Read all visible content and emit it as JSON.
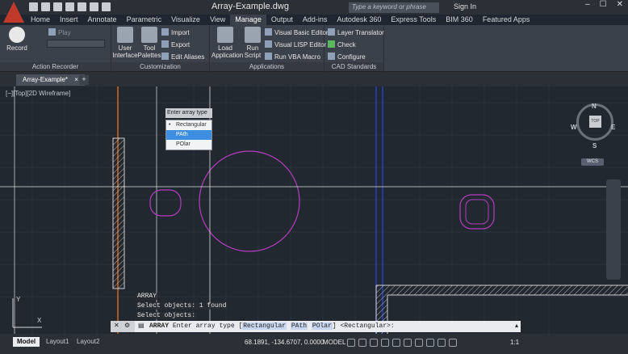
{
  "app": {
    "title": "Array-Example.dwg",
    "search_placeholder": "Type a keyword or phrase",
    "signin": "Sign In"
  },
  "ribbon_tabs": [
    "Home",
    "Insert",
    "Annotate",
    "Parametric",
    "Visualize",
    "View",
    "Manage",
    "Output",
    "Add-ins",
    "Autodesk 360",
    "Express Tools",
    "BIM 360",
    "Featured Apps"
  ],
  "active_tab": "Manage",
  "panels": {
    "action_recorder": {
      "title": "Action Recorder",
      "record": "Record",
      "play": "Play"
    },
    "customization": {
      "title": "Customization",
      "user_interface": "User Interface",
      "tool_palettes": "Tool Palettes",
      "import": "Import",
      "export": "Export",
      "edit_aliases": "Edit Aliases"
    },
    "applications": {
      "title": "Applications",
      "load_application": "Load Application",
      "run_script": "Run Script",
      "vba_editor": "Visual Basic Editor",
      "lisp_editor": "Visual LISP Editor",
      "run_vba": "Run VBA Macro"
    },
    "cad_standards": {
      "title": "CAD Standards",
      "layer_translator": "Layer Translator",
      "check": "Check",
      "configure": "Configure"
    }
  },
  "doc_tab": "Array-Example*",
  "viewport_label": "[−][Top][2D Wireframe]",
  "navcube": {
    "top": "TOP",
    "n": "N",
    "s": "S",
    "e": "E",
    "w": "W",
    "wcs": "WCS"
  },
  "popup": {
    "title": "Enter array type",
    "options": [
      "Rectangular",
      "PAth",
      "POlar"
    ],
    "selected": "PAth"
  },
  "command_history": [
    "ARRAY",
    "Select objects: 1 found",
    "Select objects:"
  ],
  "command_line": {
    "cmd": "ARRAY",
    "prompt": "Enter array type [",
    "kw1": "Rectangular",
    "kw2": "PAth",
    "kw3": "POlar",
    "suffix": "] <Rectangular>:"
  },
  "status": {
    "layouts": [
      "Model",
      "Layout1",
      "Layout2"
    ],
    "coords": "68.1891, -134.6707, 0.0000",
    "space": "MODEL",
    "scale": "1:1"
  }
}
